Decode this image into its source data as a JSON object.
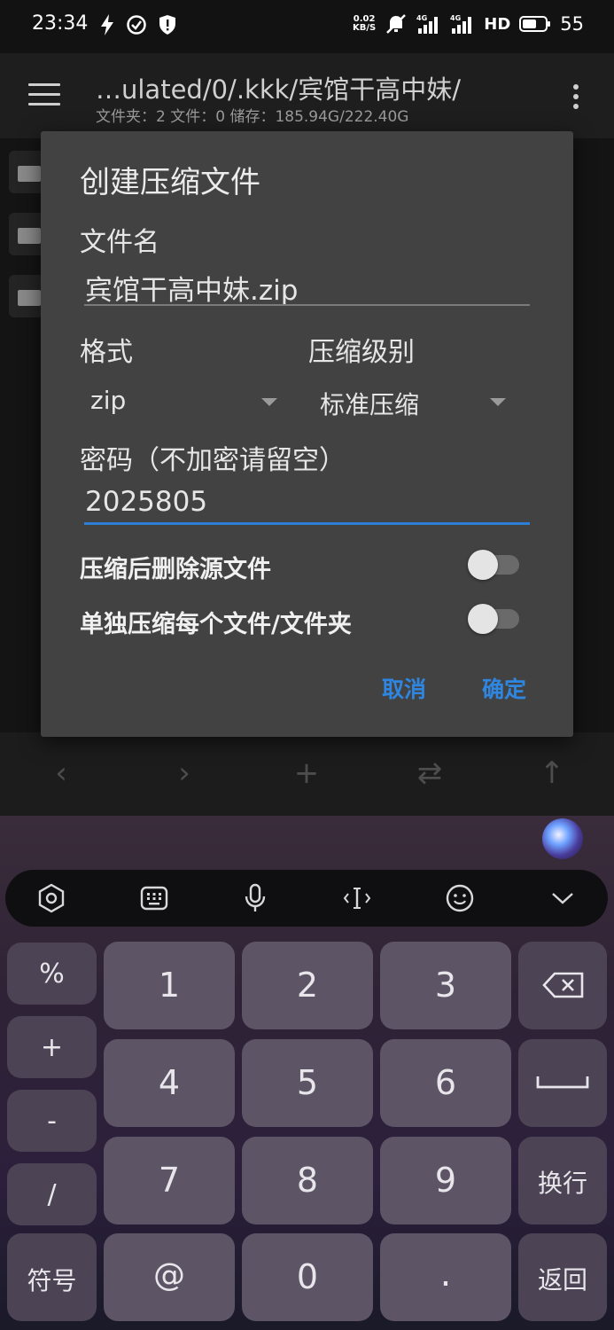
{
  "status_bar": {
    "time": "23:34",
    "speed_value": "0.02",
    "speed_unit": "KB/S",
    "network": "HD",
    "battery": "55",
    "icons": [
      "flash-icon",
      "check-circle-icon",
      "shield-icon",
      "mute-icon",
      "signal-4g-icon",
      "signal-4g-icon",
      "battery-icon"
    ]
  },
  "header": {
    "path": "…ulated/0/.kkk/宾馆干高中妹/",
    "info": "文件夹：2   文件：0   储存：185.94G/222.40G"
  },
  "dialog": {
    "title": "创建压缩文件",
    "filename_label": "文件名",
    "filename_value": "宾馆干高中妹.zip",
    "format_label": "格式",
    "format_value": "zip",
    "level_label": "压缩级别",
    "level_value": "标准压缩",
    "password_label": "密码（不加密请留空）",
    "password_value": "2025805",
    "delete_source_label": "压缩后删除源文件",
    "delete_source_on": false,
    "separate_label": "单独压缩每个文件/文件夹",
    "separate_on": false,
    "cancel_label": "取消",
    "ok_label": "确定"
  },
  "bottom_nav": {
    "icons": [
      "back-icon",
      "forward-icon",
      "add-icon",
      "swap-icon",
      "up-icon"
    ],
    "back": "‹",
    "forward": "›",
    "add": "+",
    "swap": "⇄",
    "up": "↑"
  },
  "keyboard": {
    "toolbar_icons": [
      "settings-hex-icon",
      "keyboard-icon",
      "mic-icon",
      "cursor-icon",
      "emoji-icon",
      "collapse-chevron-icon"
    ],
    "side_keys": [
      "%",
      "+",
      "-",
      "/"
    ],
    "symbols_key": "符号",
    "digits_row1": [
      "1",
      "2",
      "3"
    ],
    "digits_row2": [
      "4",
      "5",
      "6"
    ],
    "digits_row3": [
      "7",
      "8",
      "9"
    ],
    "at_key": "@",
    "zero_key": "0",
    "dot_key": ".",
    "enter_key": "换行",
    "return_key": "返回"
  }
}
